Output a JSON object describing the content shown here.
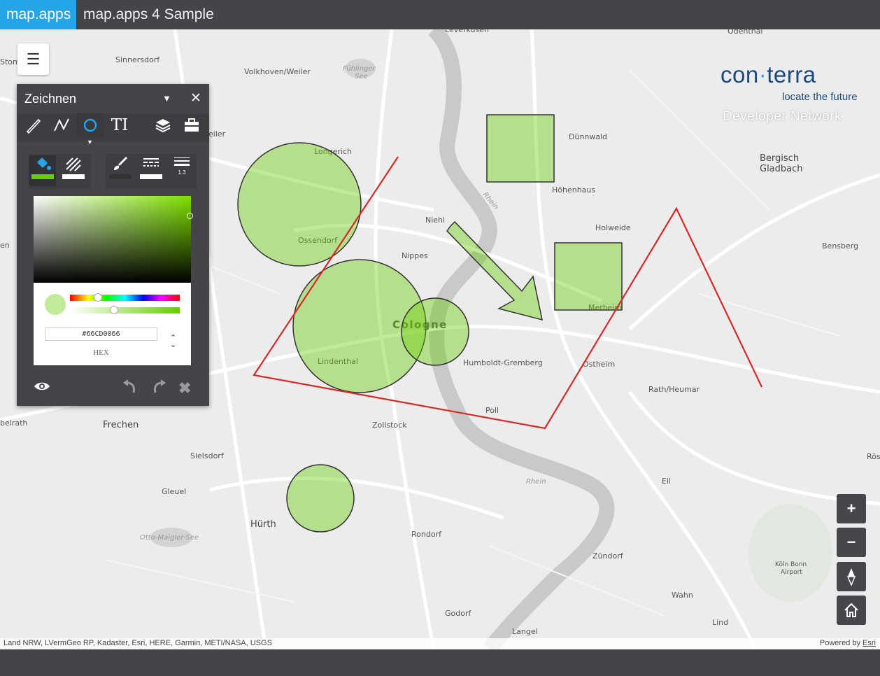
{
  "header": {
    "brand": "map.apps",
    "title": "map.apps 4 Sample"
  },
  "menu": {
    "icon": "menu-icon"
  },
  "logo": {
    "name_left": "con",
    "name_right": "terra",
    "tagline": "locate the future",
    "network": "Developer Network"
  },
  "drawing_panel": {
    "title": "Zeichnen",
    "tools": [
      "pencil-icon",
      "polyline-icon",
      "circle-icon",
      "text-icon",
      "layers-icon",
      "toolbox-icon"
    ],
    "active_tool": "circle-icon",
    "style_tools": [
      "fill-icon",
      "hatch-icon",
      "brush-icon",
      "line-style-icon",
      "line-width-icon"
    ],
    "line_width_value": "1.3",
    "color_picker": {
      "hex_value": "#66CD0066",
      "mode_label": "HEX"
    },
    "footer": [
      "visibility-icon",
      "undo-icon",
      "redo-icon",
      "delete-icon"
    ]
  },
  "map": {
    "places": [
      "Leverkusen",
      "Odenthal",
      "Sinnersdorf",
      "Volkhoven/Weiler",
      "Fühlinger See",
      "Longerich",
      "Dünnwald",
      "Bergisch Gladbach",
      "Höhenhaus",
      "Niehl",
      "Ossendorf",
      "Holweide",
      "Bensberg",
      "Nippes",
      "Merheim",
      "Cologne",
      "Lindenthal",
      "Humboldt-Gremberg",
      "Ostheim",
      "Rath/Heumar",
      "Poll",
      "Frechen",
      "Zollstock",
      "Sielsdorf",
      "Gleuel",
      "Eil",
      "Hürth",
      "Otto-Maigler-See",
      "Rondorf",
      "Zündorf",
      "Köln Bonn Airport",
      "Wahn",
      "Godorf",
      "Lind",
      "Langel",
      "Rhein",
      "Rösrath",
      "belrath",
      "Stom",
      "en",
      "eiler"
    ],
    "drawing_fill": "#66CD00",
    "line_color": "#d62828"
  },
  "controls": {
    "zoom_in": "+",
    "zoom_out": "−",
    "compass": "compass-icon",
    "home": "home-icon"
  },
  "attribution": {
    "sources": "Land NRW, LVermGeo RP, Kadaster, Esri, HERE, Garmin, METI/NASA, USGS",
    "powered_by": "Powered by",
    "powered_link": "Esri"
  }
}
